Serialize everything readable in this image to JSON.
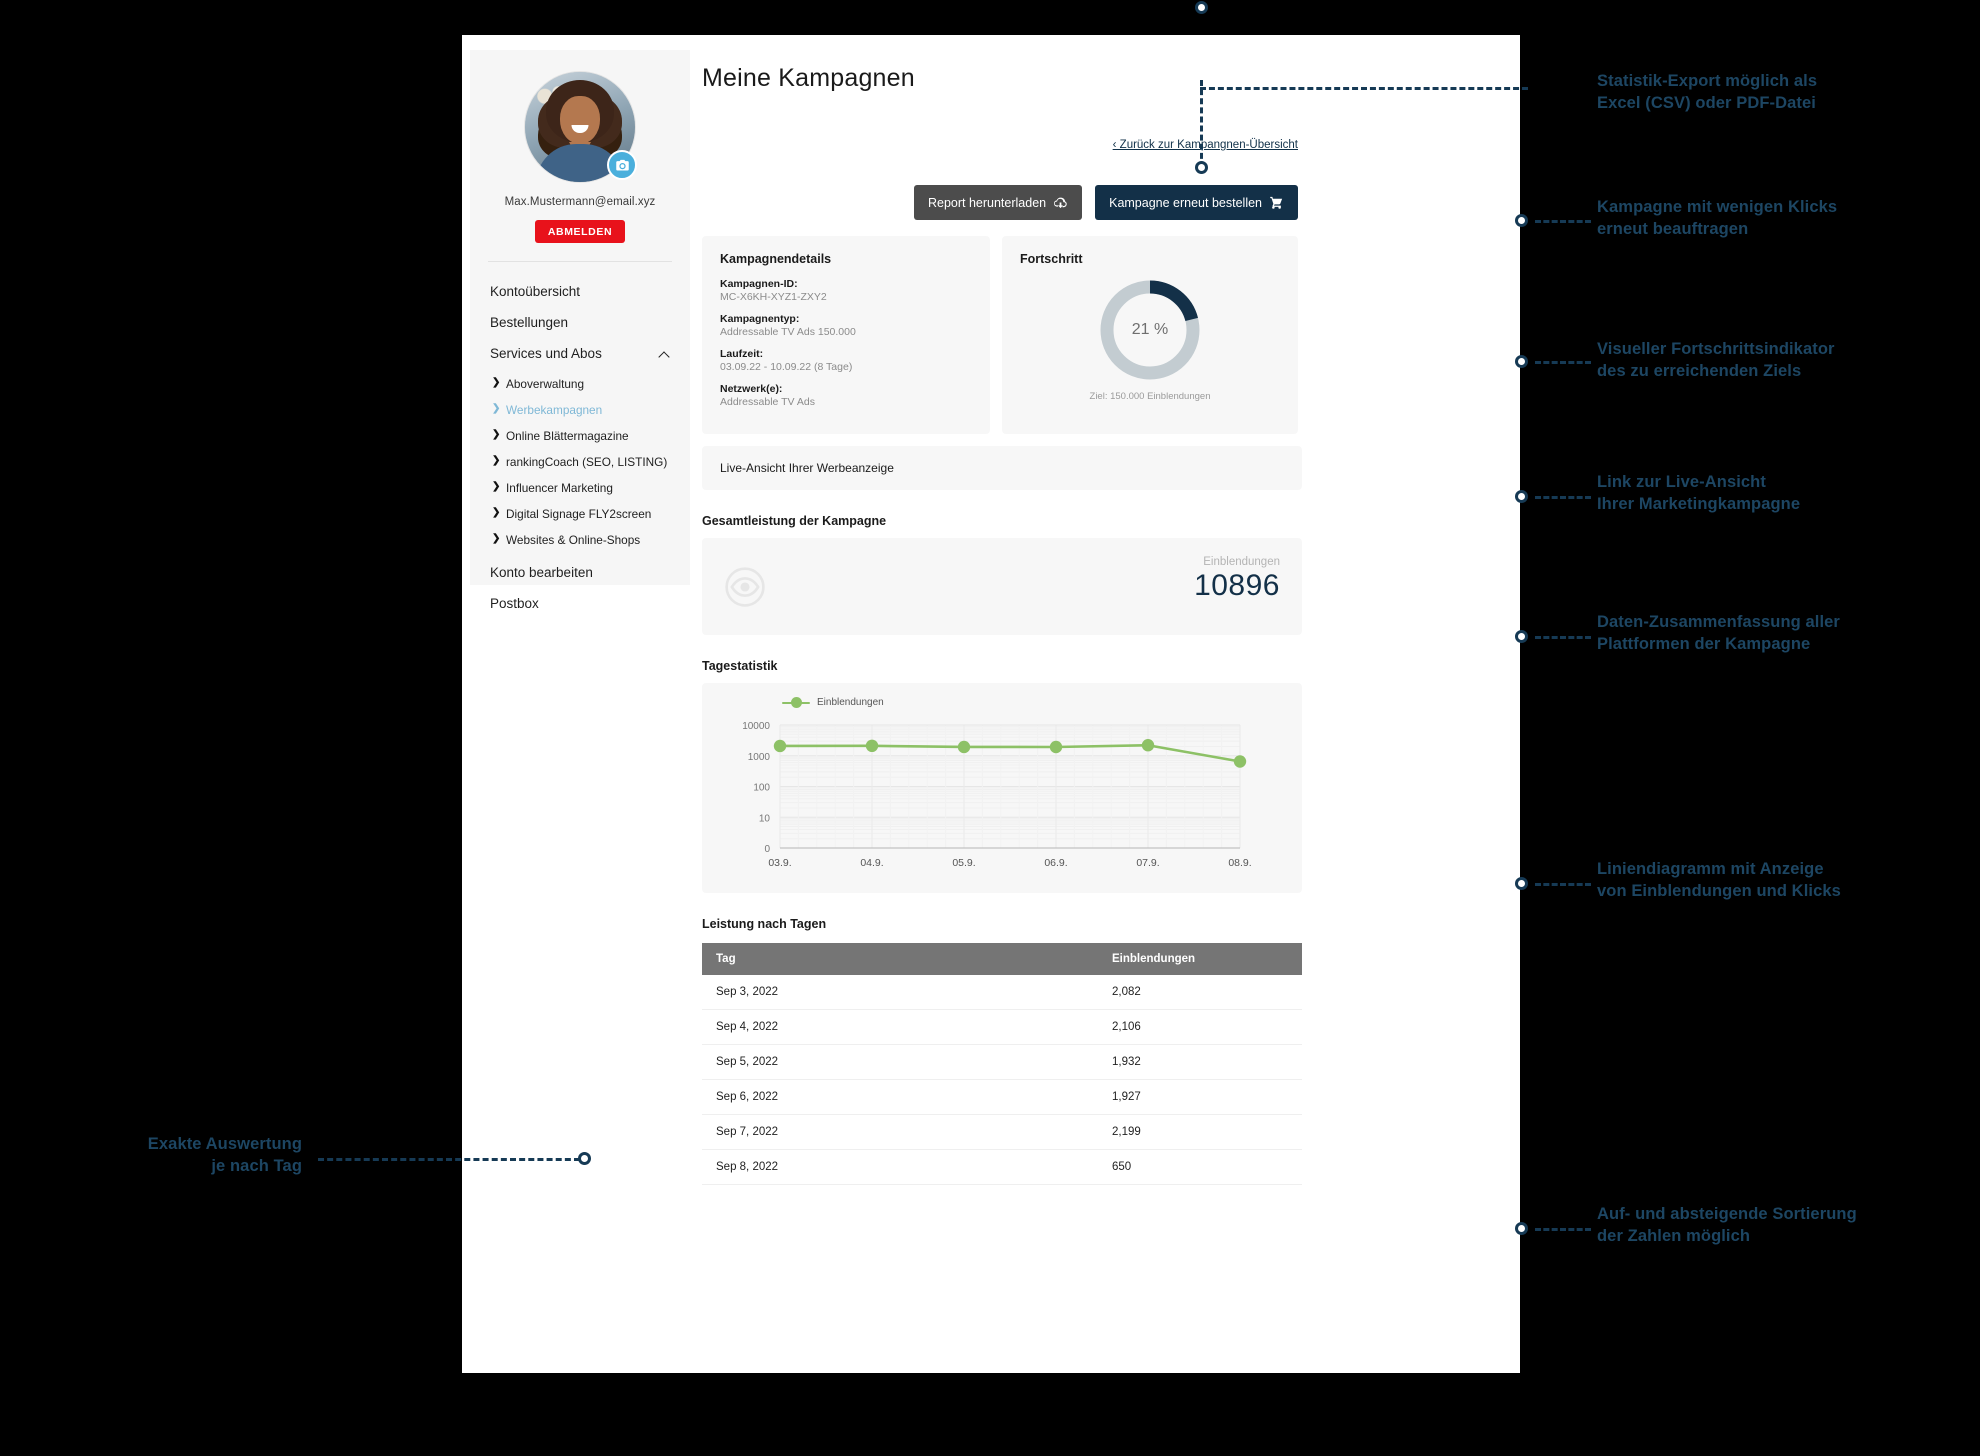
{
  "sidebar": {
    "avatar_alt": "user-avatar",
    "email": "Max.Mustermann@email.xyz",
    "logout_label": "ABMELDEN",
    "items": [
      {
        "label": "Kontoübersicht"
      },
      {
        "label": "Bestellungen"
      },
      {
        "label": "Services und Abos"
      }
    ],
    "sub_items": [
      {
        "label": "Aboverwaltung",
        "active": false
      },
      {
        "label": "Werbekampagnen",
        "active": true
      },
      {
        "label": "Online Blättermagazine",
        "active": false
      },
      {
        "label": "rankingCoach (SEO, LISTING)",
        "active": false
      },
      {
        "label": "Influencer Marketing",
        "active": false
      },
      {
        "label": "Digital Signage FLY2screen",
        "active": false
      },
      {
        "label": "Websites & Online-Shops",
        "active": false
      }
    ],
    "items_bottom": [
      {
        "label": "Konto bearbeiten"
      },
      {
        "label": "Postbox"
      }
    ]
  },
  "header": {
    "title": "Meine Kampagnen",
    "back_link": "‹ Zurück zur Kampangnen-Übersicht",
    "download_button": "Report herunterladen",
    "order_button": "Kampagne erneut bestellen"
  },
  "details": {
    "title": "Kampagnendetails",
    "rows": [
      {
        "key": "Kampagnen-ID:",
        "value": "MC-X6KH-XYZ1-ZXY2"
      },
      {
        "key": "Kampagnentyp:",
        "value": "Addressable TV Ads 150.000"
      },
      {
        "key": "Laufzeit:",
        "value": "03.09.22 - 10.09.22 (8 Tage)"
      },
      {
        "key": "Netzwerk(e):",
        "value": "Addressable TV Ads"
      }
    ]
  },
  "progress": {
    "title": "Fortschritt",
    "percent_label": "21 %",
    "percent_value": 21,
    "goal_label": "Ziel: 150.000 Einblendungen",
    "arc_color": "#133048",
    "track_color": "#c3ccd1"
  },
  "live_view": {
    "label": "Live-Ansicht Ihrer Werbeanzeige"
  },
  "summary": {
    "section_label": "Gesamtleistung der Kampagne",
    "metric_label": "Einblendungen",
    "metric_value": "10896"
  },
  "chart_section": {
    "label": "Tagestatistik"
  },
  "chart_data": {
    "type": "line",
    "title": "Tagestatistik",
    "series": [
      {
        "name": "Einblendungen",
        "color": "#8dc166",
        "values": [
          2082,
          2106,
          1932,
          1927,
          2199,
          650
        ]
      }
    ],
    "categories": [
      "03.9.",
      "04.9.",
      "05.9.",
      "06.9.",
      "07.9.",
      "08.9."
    ],
    "xlabel": "",
    "ylabel": "",
    "yscale": "log",
    "yticks": [
      "10000",
      "1000",
      "100",
      "10",
      "0"
    ],
    "ytick_values": [
      10000,
      1000,
      100,
      10,
      0
    ],
    "grid": true,
    "legend_position": "top-left",
    "legend": [
      "Einblendungen"
    ]
  },
  "table": {
    "section_label": "Leistung nach Tagen",
    "columns": [
      "Tag",
      "Einblendungen"
    ],
    "rows": [
      [
        "Sep 3, 2022",
        "2,082"
      ],
      [
        "Sep 4, 2022",
        "2,106"
      ],
      [
        "Sep 5, 2022",
        "1,932"
      ],
      [
        "Sep 6, 2022",
        "1,927"
      ],
      [
        "Sep 7, 2022",
        "2,199"
      ],
      [
        "Sep 8, 2022",
        "650"
      ]
    ]
  },
  "annotations": {
    "export": "Statistik-Export möglich als\nExcel (CSV) oder PDF-Datei",
    "reorder": "Kampagne mit wenigen Klicks\nerneut beauftragen",
    "progress": "Visueller Fortschrittsindikator\ndes zu erreichenden Ziels",
    "live": "Link zur Live-Ansicht\nIhrer Marketingkampagne",
    "summary": "Daten-Zusammenfassung aller\nPlattformen der Kampagne",
    "chart": "Liniendiagramm mit Anzeige\nvon Einblendungen und Klicks",
    "sorting": "Auf- und absteigende Sortierung\nder Zahlen möglich",
    "daily": "Exakte Auswertung\nje nach Tag"
  }
}
